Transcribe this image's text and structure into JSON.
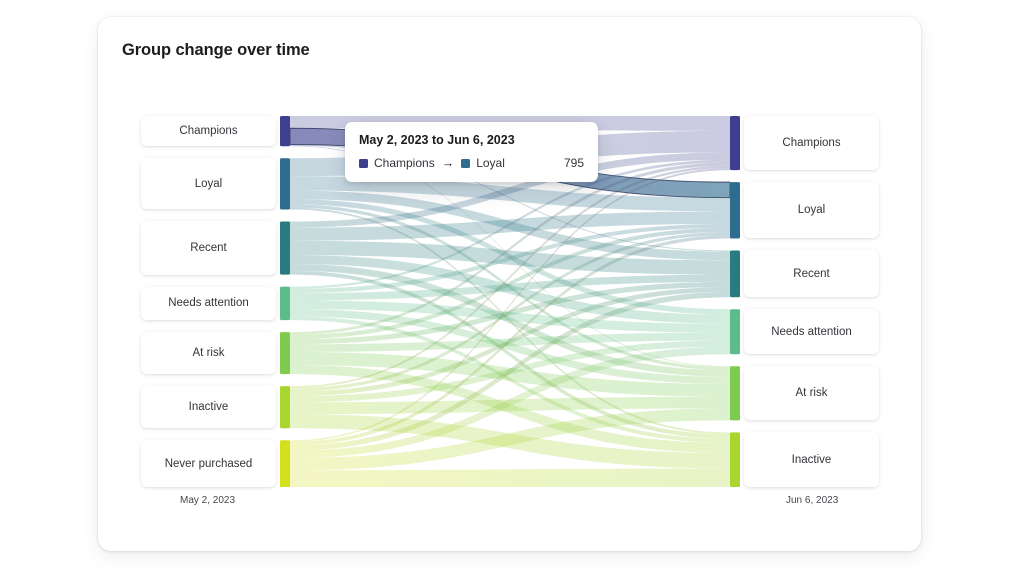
{
  "card": {
    "title": "Group change over time"
  },
  "axis": {
    "left_caption": "May 2, 2023",
    "right_caption": "Jun 6, 2023"
  },
  "tooltip": {
    "title": "May 2, 2023 to Jun 6, 2023",
    "source_label": "Champions",
    "target_label": "Loyal",
    "arrow_glyph": "→",
    "value": "795",
    "source_color": "#3f3f8f",
    "target_color": "#2e6d8e"
  },
  "palette": {
    "champions": "#3f3f8f",
    "loyal": "#2e6d8e",
    "recent": "#2a7b7f",
    "needs_attention": "#5dbd8a",
    "at_risk": "#7ecb4f",
    "inactive": "#a8d62f",
    "never_purchased": "#d4e01c"
  },
  "chart_data": {
    "type": "sankey",
    "title": "Group change over time",
    "xlabel": "",
    "ylabel": "",
    "legend_position": "none",
    "grid": false,
    "stages": [
      {
        "name": "May 2, 2023",
        "side": "left"
      },
      {
        "name": "Jun 6, 2023",
        "side": "right"
      }
    ],
    "nodes_left": [
      {
        "label": "Champions",
        "color": "#3f3f8f",
        "value": 1480
      },
      {
        "label": "Loyal",
        "color": "#2e6d8e",
        "value": 2510
      },
      {
        "label": "Recent",
        "color": "#2a7b7f",
        "value": 2600
      },
      {
        "label": "Needs attention",
        "color": "#5dbd8a",
        "value": 1640
      },
      {
        "label": "At risk",
        "color": "#7ecb4f",
        "value": 2060
      },
      {
        "label": "Inactive",
        "color": "#a8d62f",
        "value": 2060
      },
      {
        "label": "Never purchased",
        "color": "#d4e01c",
        "value": 2290
      }
    ],
    "nodes_right": [
      {
        "label": "Champions",
        "color": "#3f3f8f",
        "value": 2200
      },
      {
        "label": "Loyal",
        "color": "#2e6d8e",
        "value": 2290
      },
      {
        "label": "Recent",
        "color": "#2a7b7f",
        "value": 1900
      },
      {
        "label": "Needs attention",
        "color": "#5dbd8a",
        "value": 1830
      },
      {
        "label": "At risk",
        "color": "#7ecb4f",
        "value": 2200
      },
      {
        "label": "Inactive",
        "color": "#a8d62f",
        "value": 2220
      }
    ],
    "highlighted_link": {
      "source": "Champions",
      "target": "Loyal",
      "value": 795
    },
    "links": [
      {
        "source": "Champions",
        "target": "Champions",
        "value": 600
      },
      {
        "source": "Champions",
        "target": "Loyal",
        "value": 795
      },
      {
        "source": "Champions",
        "target": "Recent",
        "value": 50
      },
      {
        "source": "Champions",
        "target": "At risk",
        "value": 35
      },
      {
        "source": "Loyal",
        "target": "Champions",
        "value": 880
      },
      {
        "source": "Loyal",
        "target": "Loyal",
        "value": 700
      },
      {
        "source": "Loyal",
        "target": "Recent",
        "value": 420
      },
      {
        "source": "Loyal",
        "target": "Needs attention",
        "value": 260
      },
      {
        "source": "Loyal",
        "target": "At risk",
        "value": 160
      },
      {
        "source": "Loyal",
        "target": "Inactive",
        "value": 90
      },
      {
        "source": "Recent",
        "target": "Champions",
        "value": 300
      },
      {
        "source": "Recent",
        "target": "Loyal",
        "value": 640
      },
      {
        "source": "Recent",
        "target": "Recent",
        "value": 700
      },
      {
        "source": "Recent",
        "target": "Needs attention",
        "value": 440
      },
      {
        "source": "Recent",
        "target": "At risk",
        "value": 330
      },
      {
        "source": "Recent",
        "target": "Inactive",
        "value": 190
      },
      {
        "source": "Needs attention",
        "target": "Champions",
        "value": 110
      },
      {
        "source": "Needs attention",
        "target": "Loyal",
        "value": 210
      },
      {
        "source": "Needs attention",
        "target": "Recent",
        "value": 350
      },
      {
        "source": "Needs attention",
        "target": "Needs attention",
        "value": 430
      },
      {
        "source": "Needs attention",
        "target": "At risk",
        "value": 360
      },
      {
        "source": "Needs attention",
        "target": "Inactive",
        "value": 180
      },
      {
        "source": "At risk",
        "target": "Champions",
        "value": 130
      },
      {
        "source": "At risk",
        "target": "Loyal",
        "value": 210
      },
      {
        "source": "At risk",
        "target": "Recent",
        "value": 250
      },
      {
        "source": "At risk",
        "target": "Needs attention",
        "value": 380
      },
      {
        "source": "At risk",
        "target": "At risk",
        "value": 640
      },
      {
        "source": "At risk",
        "target": "Inactive",
        "value": 450
      },
      {
        "source": "Inactive",
        "target": "Champions",
        "value": 100
      },
      {
        "source": "Inactive",
        "target": "Loyal",
        "value": 160
      },
      {
        "source": "Inactive",
        "target": "Recent",
        "value": 230
      },
      {
        "source": "Inactive",
        "target": "Needs attention",
        "value": 300
      },
      {
        "source": "Inactive",
        "target": "At risk",
        "value": 580
      },
      {
        "source": "Inactive",
        "target": "Inactive",
        "value": 690
      },
      {
        "source": "Never purchased",
        "target": "Champions",
        "value": 80
      },
      {
        "source": "Never purchased",
        "target": "Loyal",
        "value": 170
      },
      {
        "source": "Never purchased",
        "target": "Recent",
        "value": 260
      },
      {
        "source": "Never purchased",
        "target": "Needs attention",
        "value": 360
      },
      {
        "source": "Never purchased",
        "target": "At risk",
        "value": 600
      },
      {
        "source": "Never purchased",
        "target": "Inactive",
        "value": 820
      }
    ]
  }
}
